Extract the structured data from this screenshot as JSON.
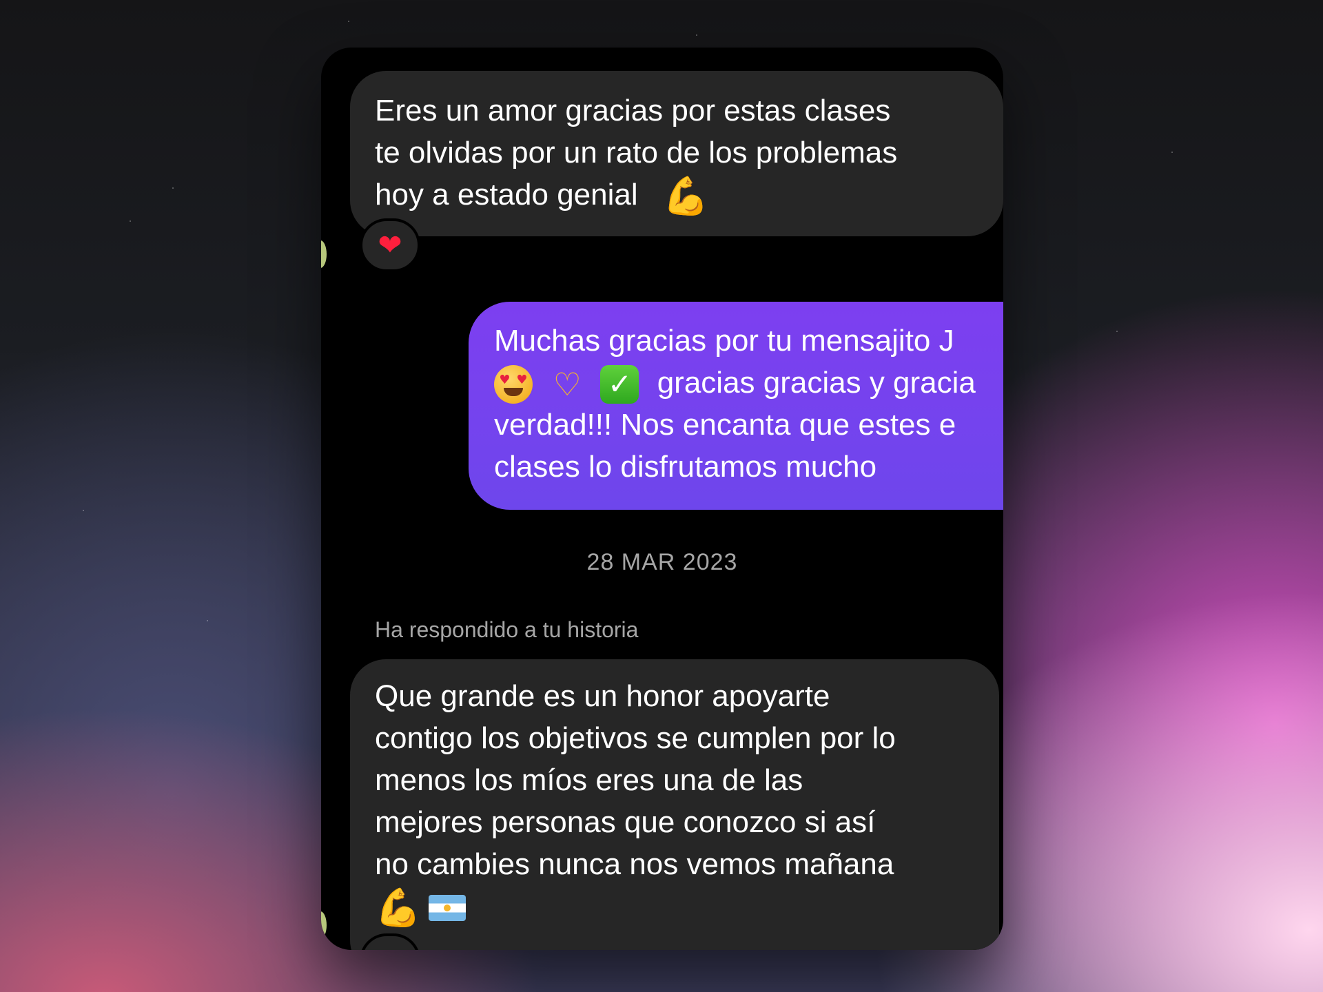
{
  "conversation": {
    "message_1": {
      "lines": [
        "Eres un amor gracias  por estas clases",
        "te olvidas por un rato de los problemas",
        "hoy a estado genial"
      ],
      "emoji_end": "💪",
      "reaction": "❤"
    },
    "message_2": {
      "line_1": "Muchas gracias por tu mensajito J",
      "line_2_text": "gracias gracias y gracia",
      "line_3": "verdad!!! Nos encanta que estes e",
      "line_4": "clases lo disfrutamos mucho",
      "emojis": [
        "heart-eyes-emoji",
        "heart-hands-emoji",
        "check-mark-emoji"
      ]
    },
    "date_separator": "28 MAR 2023",
    "story_reply_label": "Ha respondido a tu historia",
    "message_3": {
      "lines": [
        "Que grande es un honor apoyarte",
        "contigo los objetivos se cumplen por lo",
        "menos los míos  eres una de las",
        "mejores personas que conozco  si así",
        "no cambies nunca  nos vemos mañana"
      ],
      "emojis": [
        "💪",
        "argentina-flag-emoji"
      ]
    },
    "colors": {
      "incoming_bubble": "#262626",
      "outgoing_bubble": "#7443ee",
      "reaction_heart": "#ff1f3d",
      "meta_text": "#a6a6a6"
    }
  }
}
